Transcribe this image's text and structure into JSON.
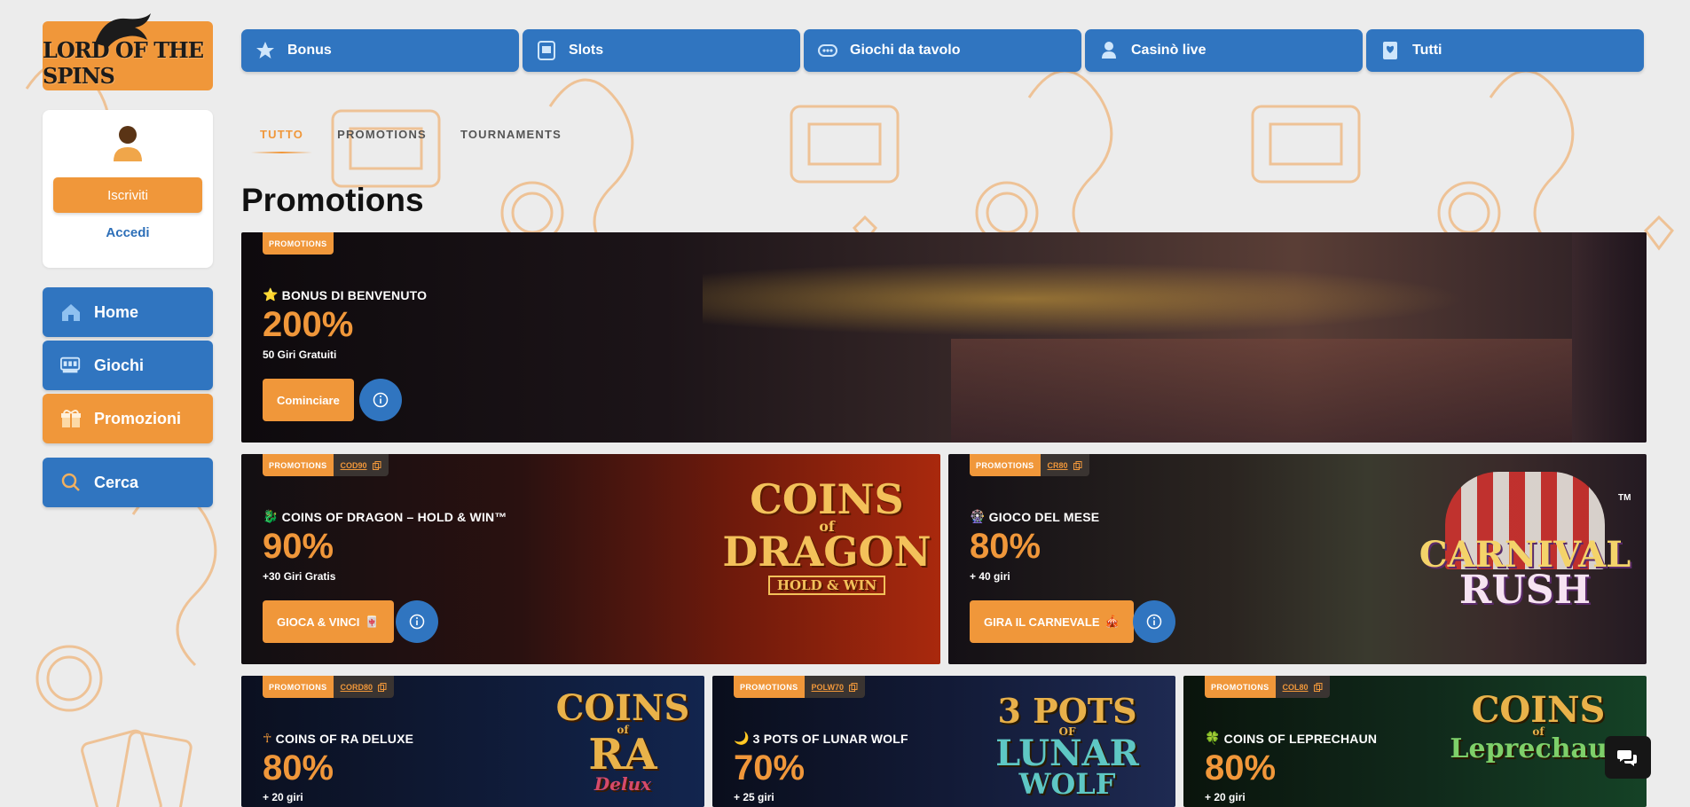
{
  "brand": {
    "logo_text": "LORD OF THE SPINS"
  },
  "user_panel": {
    "signup_label": "Iscriviti",
    "login_label": "Accedi"
  },
  "sidebar": {
    "items": [
      {
        "label": "Home",
        "icon": "home-icon",
        "active": false
      },
      {
        "label": "Giochi",
        "icon": "games-icon",
        "active": false
      },
      {
        "label": "Promozioni",
        "icon": "gift-icon",
        "active": true
      }
    ],
    "search_label": "Cerca"
  },
  "categories": [
    {
      "label": "Bonus",
      "icon": "star-icon"
    },
    {
      "label": "Slots",
      "icon": "slot-machine-icon"
    },
    {
      "label": "Giochi da tavolo",
      "icon": "table-games-icon"
    },
    {
      "label": "Casinò live",
      "icon": "live-dealer-icon"
    },
    {
      "label": "Tutti",
      "icon": "cards-icon"
    }
  ],
  "tabs": [
    {
      "label": "TUTTO",
      "active": true
    },
    {
      "label": "PROMOTIONS",
      "active": false
    },
    {
      "label": "TOURNAMENTS",
      "active": false
    }
  ],
  "page_title": "Promotions",
  "promos": [
    {
      "badge": "PROMOTIONS",
      "code": "",
      "title": "BONUS DI BENVENUTO",
      "title_icon": "⭐",
      "value": "200%",
      "subtitle": "50 Giri Gratuiti",
      "cta": "Cominciare",
      "cta_icon": ""
    },
    {
      "badge": "PROMOTIONS",
      "code": "COD90",
      "title": "COINS OF DRAGON – HOLD & WIN™",
      "title_icon": "🐉",
      "value": "90%",
      "subtitle": "+30 Giri Gratis",
      "cta": "GIOCA & VINCI",
      "cta_icon": "🀄",
      "art": {
        "line1": "COINS",
        "line2": "of",
        "line3": "DRAGON",
        "line4": "HOLD & WIN"
      }
    },
    {
      "badge": "PROMOTIONS",
      "code": "CR80",
      "title": "GIOCO DEL MESE",
      "title_icon": "🎡",
      "value": "80%",
      "subtitle": "+ 40 giri",
      "cta": "GIRA IL CARNEVALE",
      "cta_icon": "🎪",
      "art": {
        "line1": "CARNIVAL",
        "line2": "RUSH",
        "tm": "TM"
      }
    },
    {
      "badge": "PROMOTIONS",
      "code": "CORD80",
      "title": "COINS OF RA DELUXE",
      "title_icon": "☥",
      "value": "80%",
      "subtitle": "+ 20 giri",
      "art": {
        "line1": "COINS",
        "line2": "of",
        "line3": "RA",
        "line4": "Delux"
      }
    },
    {
      "badge": "PROMOTIONS",
      "code": "POLW70",
      "title": "3 POTS OF LUNAR WOLF",
      "title_icon": "🌙",
      "value": "70%",
      "subtitle": "+ 25 giri",
      "art": {
        "line1": "3 POTS",
        "line2": "OF",
        "line3": "LUNAR",
        "line4": "WOLF"
      }
    },
    {
      "badge": "PROMOTIONS",
      "code": "COL80",
      "title": "COINS OF LEPRECHAUN",
      "title_icon": "🍀",
      "value": "80%",
      "subtitle": "+ 20 giri",
      "art": {
        "line1": "COINS",
        "line2": "of",
        "line3": "Leprechaun"
      }
    }
  ],
  "colors": {
    "accent": "#f0973a",
    "primary": "#3075c0",
    "background": "#ececec"
  },
  "chat": {
    "icon": "chat-bubbles-icon"
  }
}
